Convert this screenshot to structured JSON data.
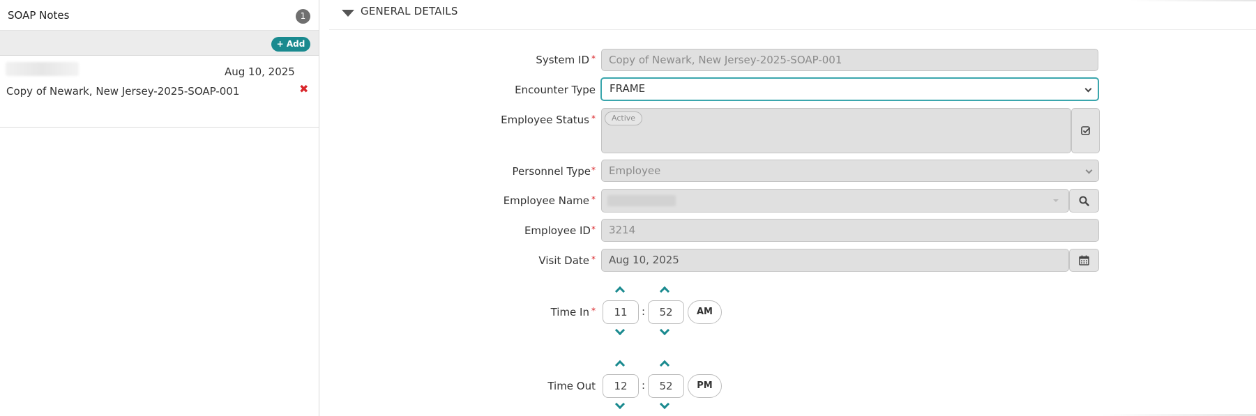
{
  "left_panel": {
    "title": "SOAP Notes",
    "count": "1",
    "add_label": "+ Add",
    "notes": [
      {
        "date": "Aug 10, 2025",
        "name": "Copy of Newark, New Jersey-2025-SOAP-001",
        "delete_glyph": "✖"
      }
    ]
  },
  "section": {
    "title": "GENERAL DETAILS"
  },
  "form": {
    "system_id": {
      "label": "System ID",
      "value": "Copy of Newark, New Jersey-2025-SOAP-001"
    },
    "encounter_type": {
      "label": "Encounter Type",
      "value": "FRAME"
    },
    "employee_status": {
      "label": "Employee Status",
      "tag": "Active"
    },
    "personnel_type": {
      "label": "Personnel Type",
      "value": "Employee"
    },
    "employee_name": {
      "label": "Employee Name"
    },
    "employee_id": {
      "label": "Employee ID",
      "value": "3214"
    },
    "visit_date": {
      "label": "Visit Date",
      "value": "Aug 10, 2025"
    },
    "time_in": {
      "label": "Time In",
      "hour": "11",
      "minute": "52",
      "ampm": "AM"
    },
    "time_out": {
      "label": "Time Out",
      "hour": "12",
      "minute": "52",
      "ampm": "PM"
    }
  },
  "required_marker": "*",
  "time_separator": ":",
  "icons": {
    "caret": "caret-down-icon",
    "check": "check-square-icon",
    "search": "search-icon",
    "calendar": "calendar-icon"
  },
  "colors": {
    "accent": "#1a8a8f",
    "required": "#d9262b",
    "focus_border": "#3aa6ad",
    "disabled_bg": "#e0e0e0"
  }
}
